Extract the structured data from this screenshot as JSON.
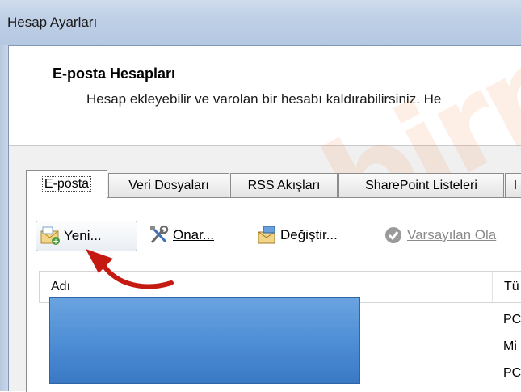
{
  "window": {
    "title": "Hesap Ayarları"
  },
  "header": {
    "heading": "E-posta Hesapları",
    "description": "Hesap ekleyebilir ve varolan bir hesabı kaldırabilirsiniz. He"
  },
  "tabs": [
    {
      "label": "E-posta",
      "active": true
    },
    {
      "label": "Veri Dosyaları"
    },
    {
      "label": "RSS Akışları"
    },
    {
      "label": "SharePoint Listeleri"
    },
    {
      "label": "I"
    }
  ],
  "toolbar": {
    "new": {
      "label": "Yeni...",
      "icon": "new-mail-icon"
    },
    "repair": {
      "label": "Onar...",
      "icon": "tools-icon"
    },
    "change": {
      "label": "Değiştir...",
      "icon": "change-account-icon"
    },
    "default": {
      "label": "Varsayılan Ola",
      "icon": "checkmark-icon",
      "disabled": true
    }
  },
  "list": {
    "columns": [
      "Adı",
      "Tü"
    ],
    "rows": [
      {
        "type": "PC"
      },
      {
        "type": "Mi"
      },
      {
        "type": "PC"
      }
    ]
  },
  "watermark": "tebirn",
  "colors": {
    "accent": "#4f8fd6",
    "arrow": "#c41a12"
  }
}
